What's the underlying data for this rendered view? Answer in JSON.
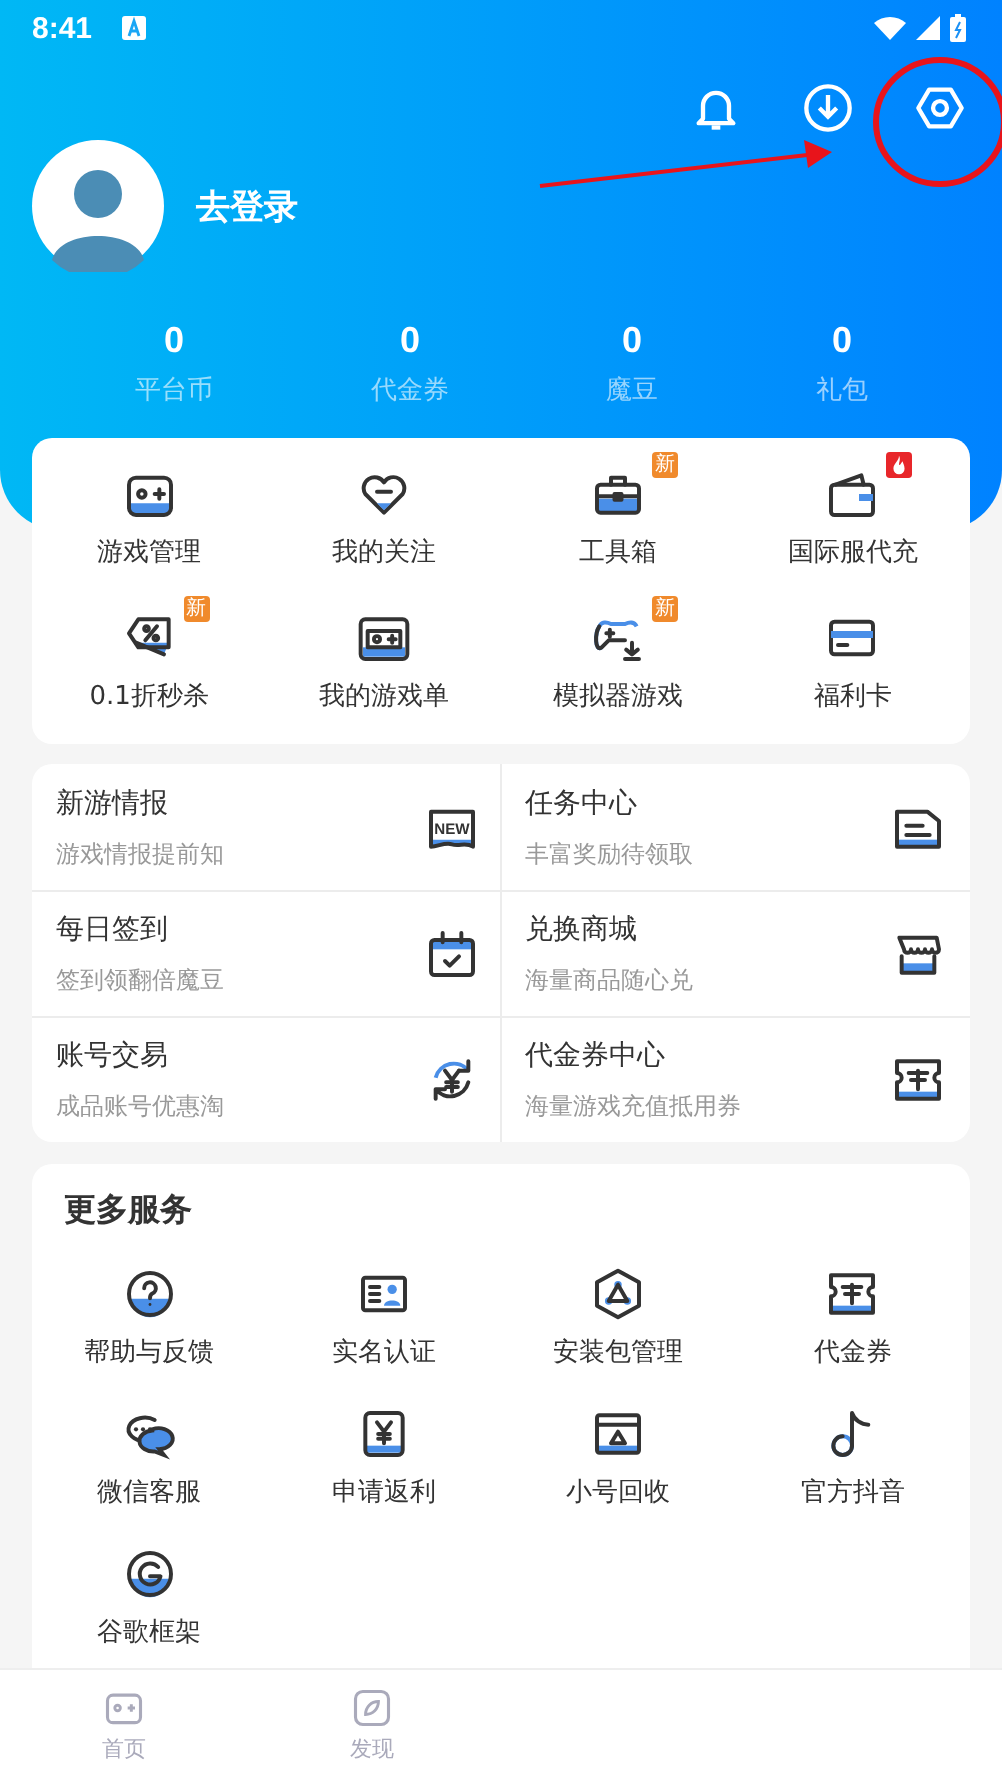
{
  "status_bar": {
    "time": "8:41"
  },
  "profile": {
    "login_label": "去登录"
  },
  "stats": [
    {
      "value": "0",
      "label": "平台币"
    },
    {
      "value": "0",
      "label": "代金券"
    },
    {
      "value": "0",
      "label": "魔豆"
    },
    {
      "value": "0",
      "label": "礼包"
    }
  ],
  "quick_tools": [
    {
      "label": "游戏管理"
    },
    {
      "label": "我的关注"
    },
    {
      "label": "工具箱",
      "badge": {
        "kind": "new",
        "text": "新"
      }
    },
    {
      "label": "国际服代充",
      "badge": {
        "kind": "hot"
      }
    },
    {
      "label": "0.1折秒杀",
      "badge": {
        "kind": "new",
        "text": "新"
      }
    },
    {
      "label": "我的游戏单"
    },
    {
      "label": "模拟器游戏",
      "badge": {
        "kind": "new",
        "text": "新"
      }
    },
    {
      "label": "福利卡"
    }
  ],
  "features": [
    {
      "title": "新游情报",
      "subtitle": "游戏情报提前知",
      "icon_label": "NEW"
    },
    {
      "title": "任务中心",
      "subtitle": "丰富奖励待领取"
    },
    {
      "title": "每日签到",
      "subtitle": "签到领翻倍魔豆"
    },
    {
      "title": "兑换商城",
      "subtitle": "海量商品随心兑"
    },
    {
      "title": "账号交易",
      "subtitle": "成品账号优惠淘"
    },
    {
      "title": "代金券中心",
      "subtitle": "海量游戏充值抵用券"
    }
  ],
  "more_services": {
    "title": "更多服务",
    "items": [
      {
        "label": "帮助与反馈"
      },
      {
        "label": "实名认证"
      },
      {
        "label": "安装包管理"
      },
      {
        "label": "代金券"
      },
      {
        "label": "微信客服"
      },
      {
        "label": "申请返利"
      },
      {
        "label": "小号回收"
      },
      {
        "label": "官方抖音"
      },
      {
        "label": "谷歌框架"
      }
    ]
  },
  "bottom_nav": [
    {
      "label": "首页"
    },
    {
      "label": "发现"
    }
  ]
}
